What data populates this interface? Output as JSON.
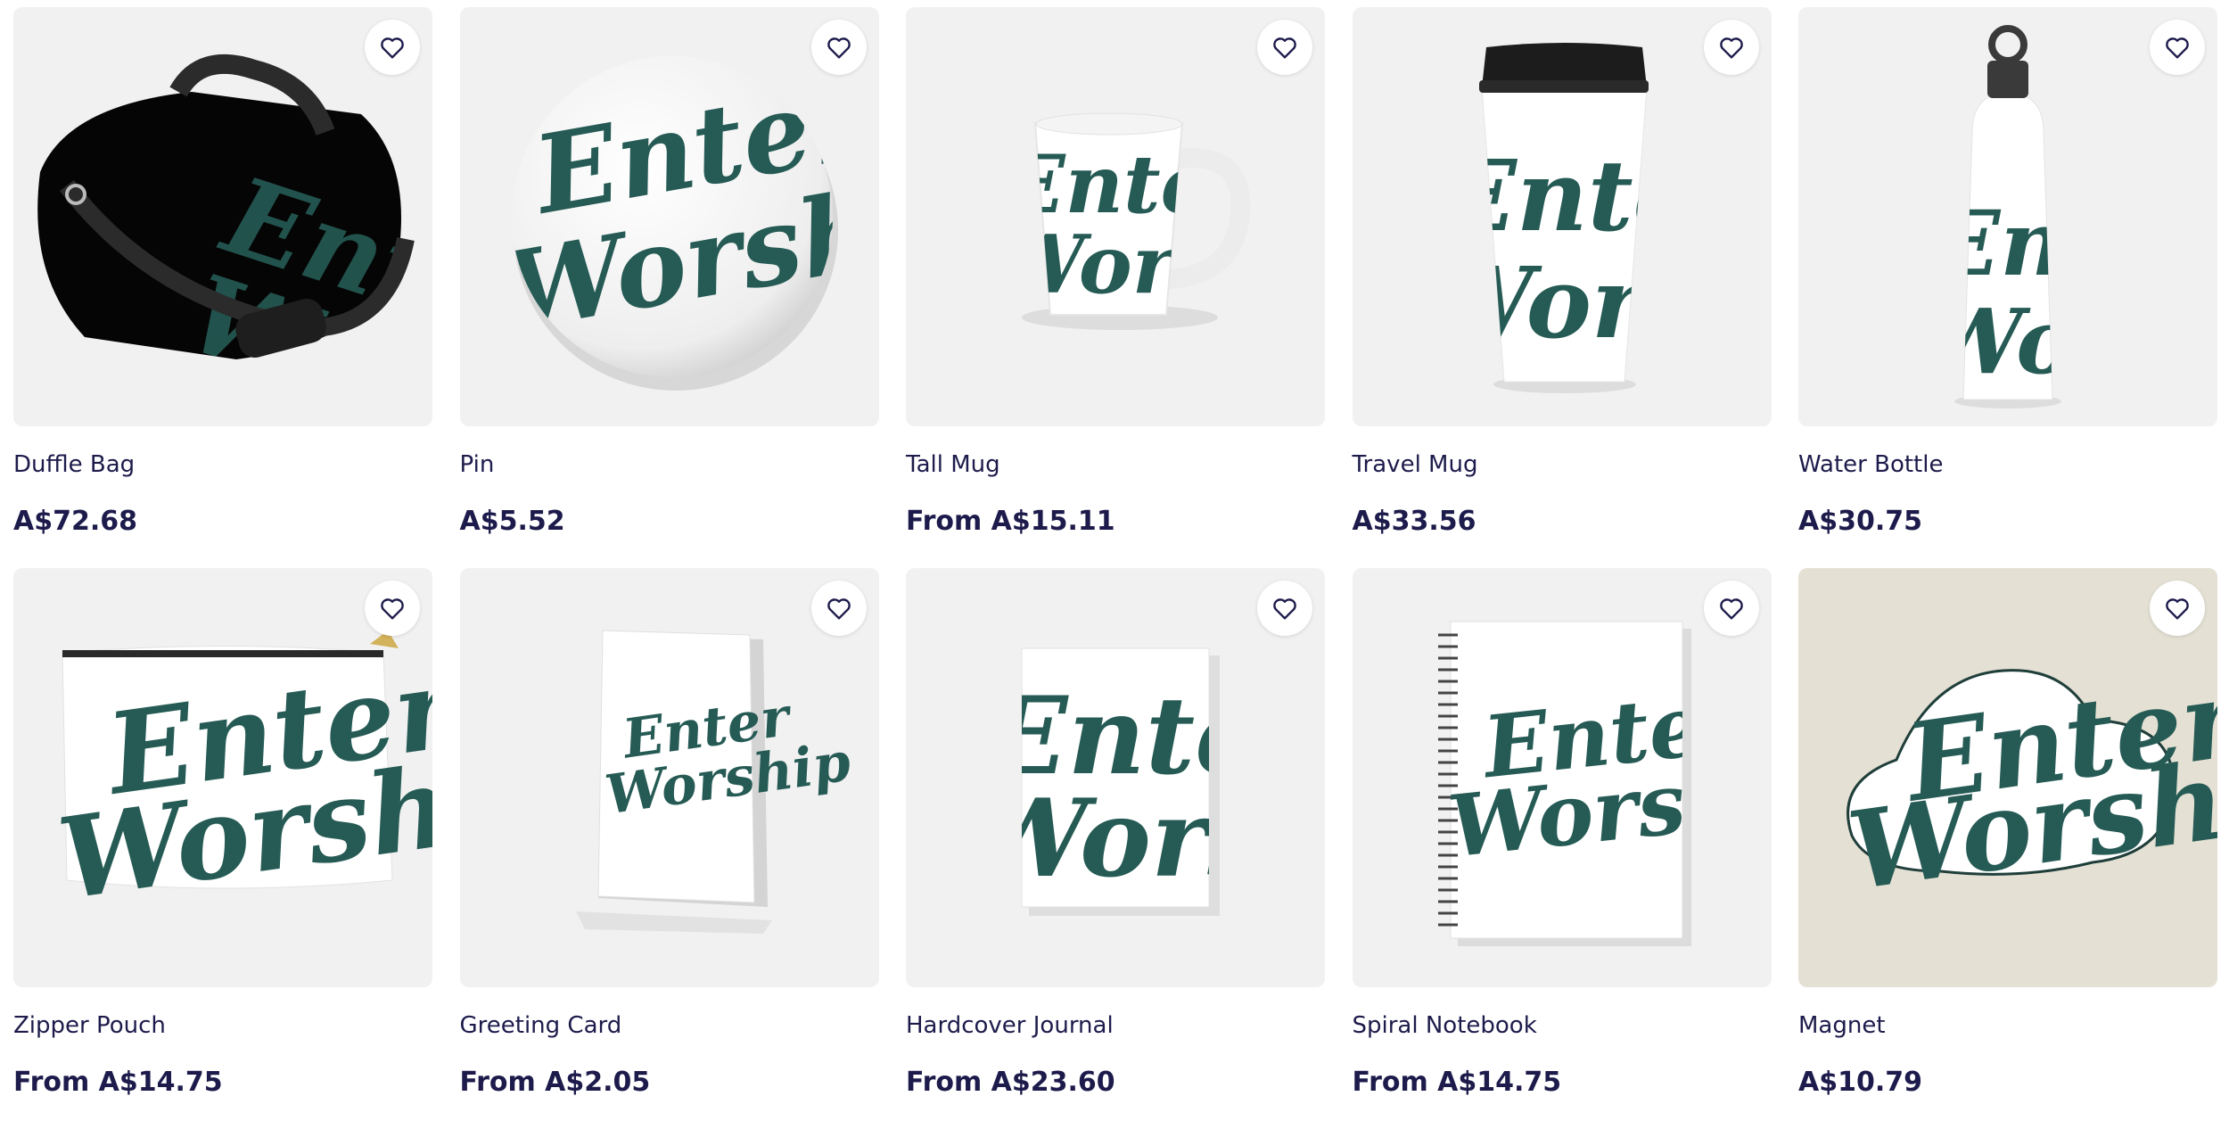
{
  "colors": {
    "text": "#1d1b4b",
    "brand_green": "#265b55",
    "tile_bg": "#f1f1f1",
    "magnet_bg": "#e4e0d4"
  },
  "design_text": {
    "line1": "Enter",
    "line2": "Worship"
  },
  "products": [
    {
      "name": "Duffle Bag",
      "price": "A$72.68",
      "icon": "heart-outline-icon"
    },
    {
      "name": "Pin",
      "price": "A$5.52",
      "icon": "heart-outline-icon"
    },
    {
      "name": "Tall Mug",
      "price": "From A$15.11",
      "icon": "heart-outline-icon"
    },
    {
      "name": "Travel Mug",
      "price": "A$33.56",
      "icon": "heart-outline-icon"
    },
    {
      "name": "Water Bottle",
      "price": "A$30.75",
      "icon": "heart-outline-icon"
    },
    {
      "name": "Zipper Pouch",
      "price": "From A$14.75",
      "icon": "heart-outline-icon"
    },
    {
      "name": "Greeting Card",
      "price": "From A$2.05",
      "icon": "heart-outline-icon"
    },
    {
      "name": "Hardcover Journal",
      "price": "From A$23.60",
      "icon": "heart-outline-icon"
    },
    {
      "name": "Spiral Notebook",
      "price": "From A$14.75",
      "icon": "heart-outline-icon"
    },
    {
      "name": "Magnet",
      "price": "A$10.79",
      "icon": "heart-outline-icon"
    }
  ]
}
